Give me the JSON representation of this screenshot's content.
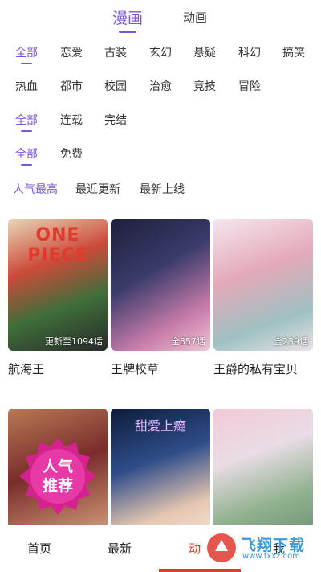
{
  "top_tabs": [
    {
      "label": "漫画",
      "active": true
    },
    {
      "label": "动画",
      "active": false
    }
  ],
  "filters": {
    "genre_row1": [
      "全部",
      "恋爱",
      "古装",
      "玄幻",
      "悬疑",
      "科幻",
      "搞笑"
    ],
    "genre_row2": [
      "热血",
      "都市",
      "校园",
      "治愈",
      "竞技",
      "冒险"
    ],
    "status": [
      "全部",
      "连载",
      "完结"
    ],
    "price": [
      "全部",
      "免费"
    ],
    "sort": [
      "人气最高",
      "最近更新",
      "最新上线"
    ]
  },
  "comics": [
    {
      "title": "航海王",
      "episodes": "更新至1094话",
      "cover_art": "ONE PIECE"
    },
    {
      "title": "王牌校草",
      "episodes": "全357话"
    },
    {
      "title": "王爵的私有宝贝",
      "episodes": "全239话"
    },
    {
      "badge": [
        "人气",
        "推荐"
      ]
    },
    {
      "cover_art": "甜爱上瘾"
    },
    {}
  ],
  "bottom_nav": {
    "items": [
      "首页",
      "最新",
      "动",
      "我"
    ],
    "active_index": 2
  },
  "watermark": {
    "text": "飞翔下载",
    "sub": "www.fxxz.com"
  },
  "colors": {
    "accent": "#7b55d6",
    "nav_active": "#e03a2f"
  }
}
